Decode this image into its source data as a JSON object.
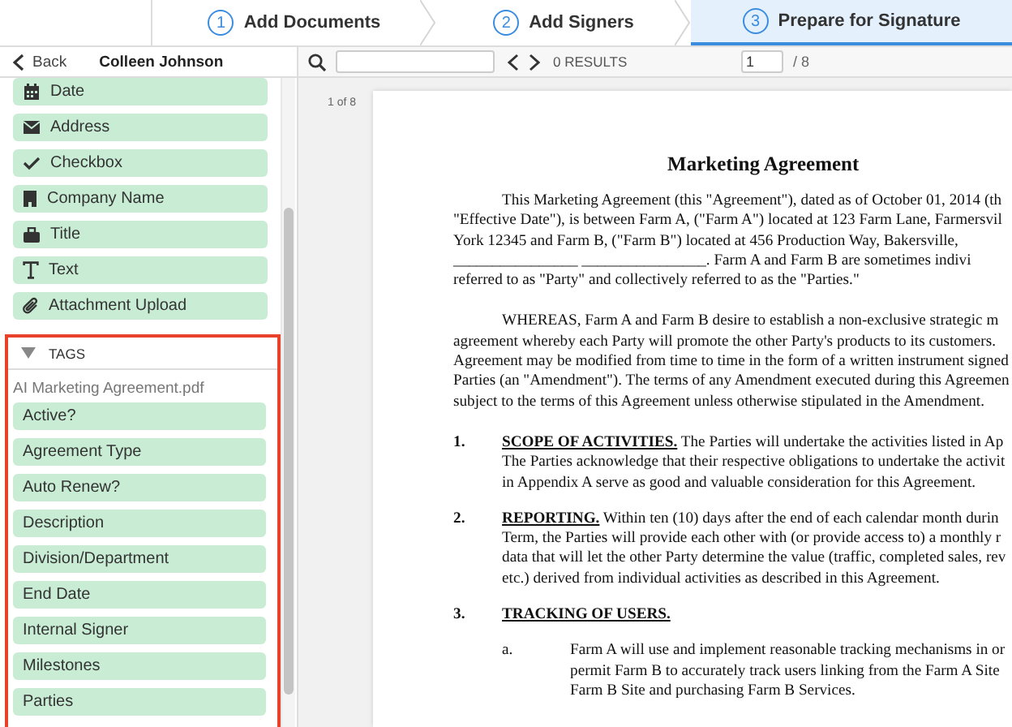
{
  "steps": [
    {
      "number": "1",
      "label": "Add Documents",
      "selected": false
    },
    {
      "number": "2",
      "label": "Add Signers",
      "selected": false
    },
    {
      "number": "3",
      "label": "Prepare for Signature",
      "selected": true
    }
  ],
  "sidebar": {
    "back": "Back",
    "signer": "Colleen Johnson",
    "fields": [
      "Date",
      "Address",
      "Checkbox",
      "Company Name",
      "Title",
      "Text",
      "Attachment Upload"
    ],
    "tags": {
      "title": "TAGS",
      "expanded": true,
      "file": "AI Marketing Agreement.pdf",
      "items": [
        "Active?",
        "Agreement Type",
        "Auto Renew?",
        "Description",
        "Division/Department",
        "End Date",
        "Internal Signer",
        "Milestones",
        "Parties"
      ]
    }
  },
  "toolbar": {
    "results": "0 RESULTS",
    "page": "1",
    "total": "/ 8"
  },
  "document": {
    "page_label": "1 of 8",
    "title": "Marketing Agreement",
    "paragraphs": [
      [
        "This Marketing Agreement (this \"Agreement\"), dated as of October 01, 2014 (th",
        "\"Effective Date\"), is between Farm A, (\"Farm A\") located at 123 Farm Lane, Farmersvil",
        "York 12345 and Farm B, (\"Farm B\") located at 456 Production Way, Bakersville,",
        "________________ ________________. Farm A and Farm B are sometimes indivi",
        "referred to as \"Party\" and collectively referred to as the \"Parties.\""
      ],
      [
        "WHEREAS, Farm A and Farm B desire to establish a non-exclusive strategic m",
        "agreement whereby each Party will promote the other Party's products to its customers.",
        "Agreement may be modified from time to time in the form of a written instrument signed",
        "Parties (an \"Amendment\"). The terms of any Amendment executed during this Agreemen",
        "subject to the terms of this Agreement unless otherwise stipulated in the Amendment."
      ]
    ],
    "sections": [
      {
        "number": "1.",
        "heading": "SCOPE OF ACTIVITIES.",
        "lines": [
          "The Parties will undertake the activities listed in Ap",
          "The Parties acknowledge that their respective obligations to undertake the activit",
          "in Appendix A serve as good and valuable consideration for this Agreement."
        ]
      },
      {
        "number": "2.",
        "heading": "REPORTING.",
        "lines": [
          "Within ten (10) days after the end of each calendar month durin",
          "Term, the Parties will provide each other with (or provide access to) a monthly r",
          "data that will let the other Party determine the value (traffic, completed sales, rev",
          "etc.) derived from individual activities as described in this Agreement."
        ]
      },
      {
        "number": "3.",
        "heading": "TRACKING OF USERS.",
        "subitems": [
          {
            "letter": "a.",
            "lines": [
              "Farm A will use and implement reasonable tracking mechanisms in or",
              "permit Farm B to accurately track users linking from the Farm A Site",
              "Farm B Site and purchasing Farm B Services."
            ]
          }
        ]
      }
    ]
  }
}
